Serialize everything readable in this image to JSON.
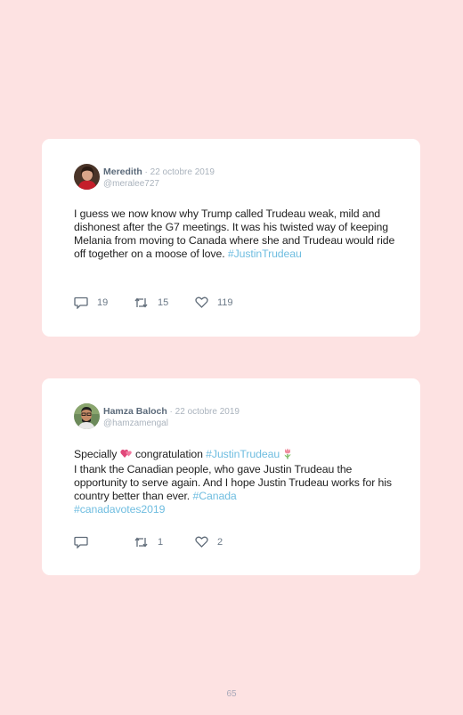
{
  "tweets": [
    {
      "name": "Meredith",
      "dot": " · ",
      "date": "22 octobre 2019",
      "handle": "@meralee727",
      "text": "I guess we now know why Trump called Trudeau weak, mild and dishonest after the G7 meetings. It was his twisted way of keeping Melania from moving to Canada where she and Trudeau would ride off together on a moose of love.",
      "hashtag": "#JustinTrudeau",
      "replies": "19",
      "retweets": "15",
      "likes": "119"
    },
    {
      "name": "Hamza Baloch",
      "dot": " · ",
      "date": "22 octobre 2019",
      "handle": "@hamzamengal",
      "text_a": "Specially",
      "emoji_heart": "💞",
      "text_b": "congratulation",
      "hashtag_a": "#JustinTrudeau",
      "emoji_flower": "🌷",
      "text_c": "I thank the Canadian people, who gave Justin Trudeau the opportunity to serve again. And I hope Justin Trudeau works for his country better than ever.",
      "hashtag_b": "#Canada",
      "hashtag_c": "#canadavotes2019",
      "replies": "",
      "retweets": "1",
      "likes": "2"
    }
  ],
  "icons": [
    "reply-icon",
    "retweet-icon",
    "like-icon"
  ],
  "colors": {
    "background": "#fde2e2",
    "hashtag": "#6fbde0"
  },
  "page_number": "65"
}
